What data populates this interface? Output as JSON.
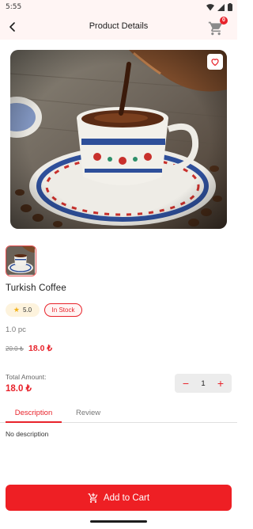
{
  "status_bar": {
    "time": "5:55"
  },
  "header": {
    "title": "Product Details",
    "cart_count": "0"
  },
  "product": {
    "name": "Turkish Coffee",
    "rating": "5.0",
    "stock_status": "In Stock",
    "unit": "1.0 pc",
    "old_price": "20.0 ₺",
    "price": "18.0 ₺",
    "image_icon": "turkish-coffee-photo"
  },
  "total": {
    "label": "Total Amount:",
    "value": "18.0 ₺"
  },
  "quantity": {
    "value": "1",
    "minus": "−",
    "plus": "+"
  },
  "tabs": [
    {
      "label": "Description",
      "active": true
    },
    {
      "label": "Review",
      "active": false
    }
  ],
  "description": "No description",
  "actions": {
    "add_to_cart": "Add to Cart"
  },
  "colors": {
    "accent": "#e8232b",
    "header_bg": "#fff5f4",
    "button": "#ee1f24"
  }
}
